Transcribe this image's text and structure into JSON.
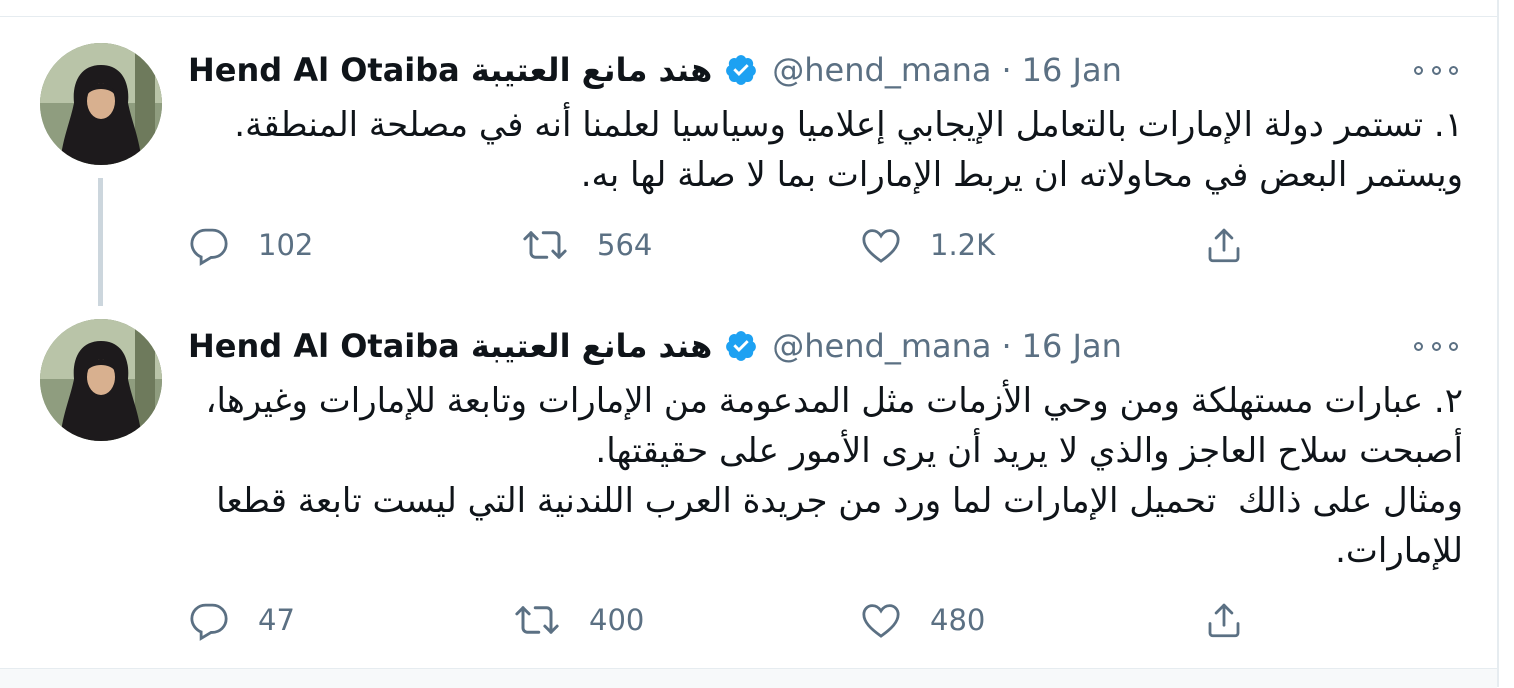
{
  "tweets": [
    {
      "display_name": "Hend Al Otaiba هند مانع العتيبة",
      "handle": "@hend_mana",
      "separator": "·",
      "time": "16 Jan",
      "text": "١. تستمر دولة الإمارات بالتعامل الإيجابي إعلاميا وسياسيا لعلمنا أنه في مصلحة المنطقة. ويستمر البعض في محاولاته ان يربط الإمارات بما لا صلة لها به.",
      "replies": "102",
      "retweets": "564",
      "likes": "1.2K"
    },
    {
      "display_name": "Hend Al Otaiba هند مانع العتيبة",
      "handle": "@hend_mana",
      "separator": "·",
      "time": "16 Jan",
      "text": "٢. عبارات مستهلكة ومن وحي الأزمات مثل المدعومة من الإمارات وتابعة للإمارات وغيرها، أصبحت سلاح العاجز والذي لا يريد أن يرى الأمور على حقيقتها.\nومثال على ذالك  تحميل الإمارات لما ورد من جريدة العرب اللندنية التي ليست تابعة قطعا للإمارات.",
      "replies": "47",
      "retweets": "400",
      "likes": "480"
    }
  ],
  "icons": {
    "reply": "reply-icon",
    "retweet": "retweet-icon",
    "like": "like-icon",
    "share": "share-icon",
    "verified": "verified-badge-icon",
    "more": "more-options-icon"
  },
  "colors": {
    "verified_blue": "#1da1f2",
    "secondary_text": "#5b7083",
    "divider": "#e6ecf0",
    "thread_line": "#ccd6dd"
  }
}
